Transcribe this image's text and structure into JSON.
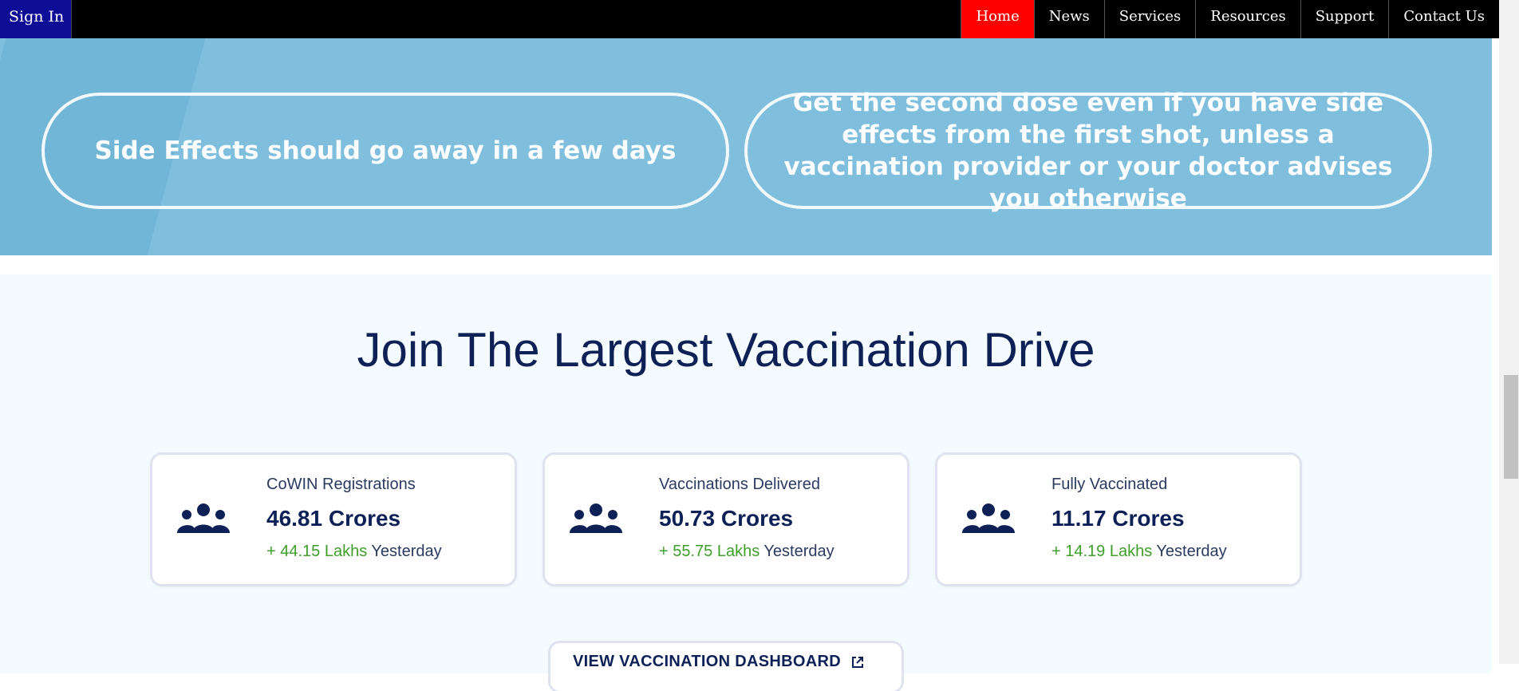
{
  "nav": {
    "signin": "Sign In",
    "items": [
      "Home",
      "News",
      "Services",
      "Resources",
      "Support",
      "Contact Us"
    ],
    "active": "Home"
  },
  "banner": {
    "pill1": "Side Effects should go away in a few days",
    "pill2": "Get the second dose even if you have side effects from the first shot, unless a vaccination provider or your doctor advises you otherwise"
  },
  "section": {
    "heading": "Join The Largest Vaccination Drive",
    "cards": [
      {
        "label": "CoWIN Registrations",
        "value": "46.81 Crores",
        "delta": "+ 44.15 Lakhs",
        "suffix": "Yesterday",
        "icon": "people-group-icon"
      },
      {
        "label": "Vaccinations Delivered",
        "value": "50.73 Crores",
        "delta": "+ 55.75 Lakhs",
        "suffix": "Yesterday",
        "icon": "people-group-icon"
      },
      {
        "label": "Fully Vaccinated",
        "value": "11.17 Crores",
        "delta": "+ 14.19 Lakhs",
        "suffix": "Yesterday",
        "icon": "people-group-icon"
      }
    ],
    "dashboard_button": "VIEW VACCINATION DASHBOARD",
    "dashboard_icon": "external-link-icon"
  },
  "colors": {
    "active_nav": "#ff0000",
    "signin_bg": "#0d0d96",
    "banner_bg": "#7fbfdd",
    "heading": "#0d2157",
    "delta_green": "#3e9f29"
  }
}
